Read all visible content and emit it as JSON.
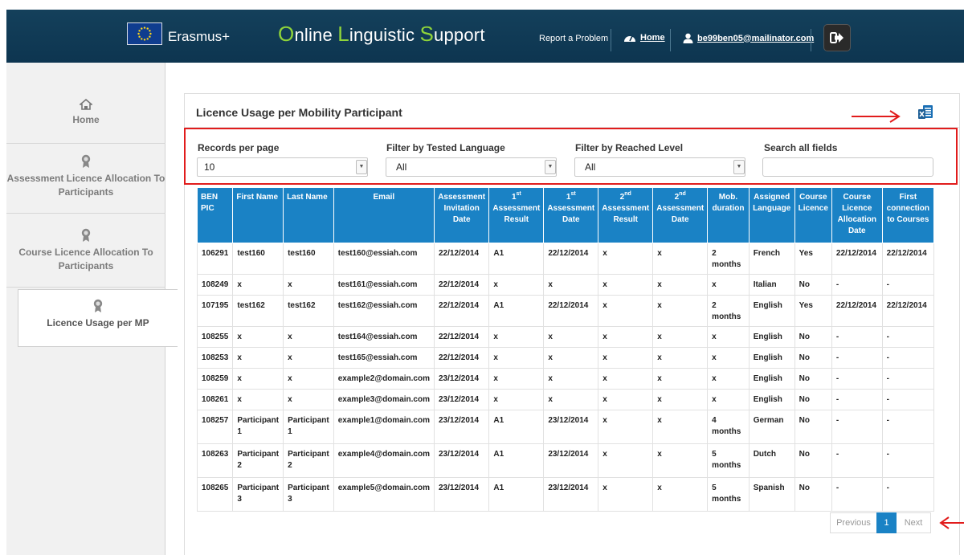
{
  "header": {
    "brand": "Erasmus+",
    "app_title_parts": [
      {
        "cap": "O",
        "rest": "nline "
      },
      {
        "cap": "L",
        "rest": "inguistic "
      },
      {
        "cap": "S",
        "rest": "upport"
      }
    ],
    "report_problem": "Report a Problem",
    "home_link": "Home",
    "user_email": "be99ben05@mailinator.com"
  },
  "sidebar": {
    "items": [
      {
        "label": "Home"
      },
      {
        "label": "Assessment Licence Allocation To Participants"
      },
      {
        "label": "Course Licence Allocation To Participants"
      },
      {
        "label": "Licence Usage per MP"
      }
    ]
  },
  "panel": {
    "title": "Licence Usage per Mobility Participant"
  },
  "filters": {
    "records_per_page_label": "Records per page",
    "records_per_page_value": "10",
    "tested_language_label": "Filter by Tested Language",
    "tested_language_value": "All",
    "reached_level_label": "Filter by Reached Level",
    "reached_level_value": "All",
    "search_label": "Search all fields",
    "search_value": ""
  },
  "table": {
    "columns": [
      {
        "text": "BEN PIC"
      },
      {
        "text": "First Name"
      },
      {
        "text": "Last Name"
      },
      {
        "text": "Email"
      },
      {
        "text": "Assessment Invitation Date"
      },
      {
        "pre": "1",
        "sup": "st",
        "text": "Assessment Result"
      },
      {
        "pre": "1",
        "sup": "st",
        "text": "Assessment Date"
      },
      {
        "pre": "2",
        "sup": "nd",
        "text": "Assessment Result"
      },
      {
        "pre": "2",
        "sup": "nd",
        "text": "Assessment Date"
      },
      {
        "text": "Mob. duration"
      },
      {
        "text": "Assigned Language"
      },
      {
        "text": "Course Licence"
      },
      {
        "text": "Course Licence Allocation Date"
      },
      {
        "text": "First connection to Courses"
      }
    ],
    "rows": [
      [
        "106291",
        "test160",
        "test160",
        "test160@essiah.com",
        "22/12/2014",
        "A1",
        "22/12/2014",
        "x",
        "x",
        "2 months",
        "French",
        "Yes",
        "22/12/2014",
        "22/12/2014"
      ],
      [
        "108249",
        "x",
        "x",
        "test161@essiah.com",
        "22/12/2014",
        "x",
        "x",
        "x",
        "x",
        "x",
        "Italian",
        "No",
        "-",
        "-"
      ],
      [
        "107195",
        "test162",
        "test162",
        "test162@essiah.com",
        "22/12/2014",
        "A1",
        "22/12/2014",
        "x",
        "x",
        "2 months",
        "English",
        "Yes",
        "22/12/2014",
        "22/12/2014"
      ],
      [
        "108255",
        "x",
        "x",
        "test164@essiah.com",
        "22/12/2014",
        "x",
        "x",
        "x",
        "x",
        "x",
        "English",
        "No",
        "-",
        "-"
      ],
      [
        "108253",
        "x",
        "x",
        "test165@essiah.com",
        "22/12/2014",
        "x",
        "x",
        "x",
        "x",
        "x",
        "English",
        "No",
        "-",
        "-"
      ],
      [
        "108259",
        "x",
        "x",
        "example2@domain.com",
        "23/12/2014",
        "x",
        "x",
        "x",
        "x",
        "x",
        "English",
        "No",
        "-",
        "-"
      ],
      [
        "108261",
        "x",
        "x",
        "example3@domain.com",
        "23/12/2014",
        "x",
        "x",
        "x",
        "x",
        "x",
        "English",
        "No",
        "-",
        "-"
      ],
      [
        "108257",
        "Participant 1",
        "Participant 1",
        "example1@domain.com",
        "23/12/2014",
        "A1",
        "23/12/2014",
        "x",
        "x",
        "4 months",
        "German",
        "No",
        "-",
        "-"
      ],
      [
        "108263",
        "Participant 2",
        "Participant 2",
        "example4@domain.com",
        "23/12/2014",
        "A1",
        "23/12/2014",
        "x",
        "x",
        "5 months",
        "Dutch",
        "No",
        "-",
        "-"
      ],
      [
        "108265",
        "Participant 3",
        "Participant 3",
        "example5@domain.com",
        "23/12/2014",
        "A1",
        "23/12/2014",
        "x",
        "x",
        "5 months",
        "Spanish",
        "No",
        "-",
        "-"
      ]
    ]
  },
  "pagination": {
    "previous": "Previous",
    "current": "1",
    "next": "Next"
  },
  "colors": {
    "header_bg": "#0d3550",
    "accent_green": "#8fd43a",
    "table_header": "#1a82c5",
    "annotation_red": "#e11c1c"
  },
  "icons": [
    "eu-flag-icon",
    "dashboard-icon",
    "user-icon",
    "logout-icon",
    "home-icon",
    "award-icon",
    "export-icon"
  ]
}
